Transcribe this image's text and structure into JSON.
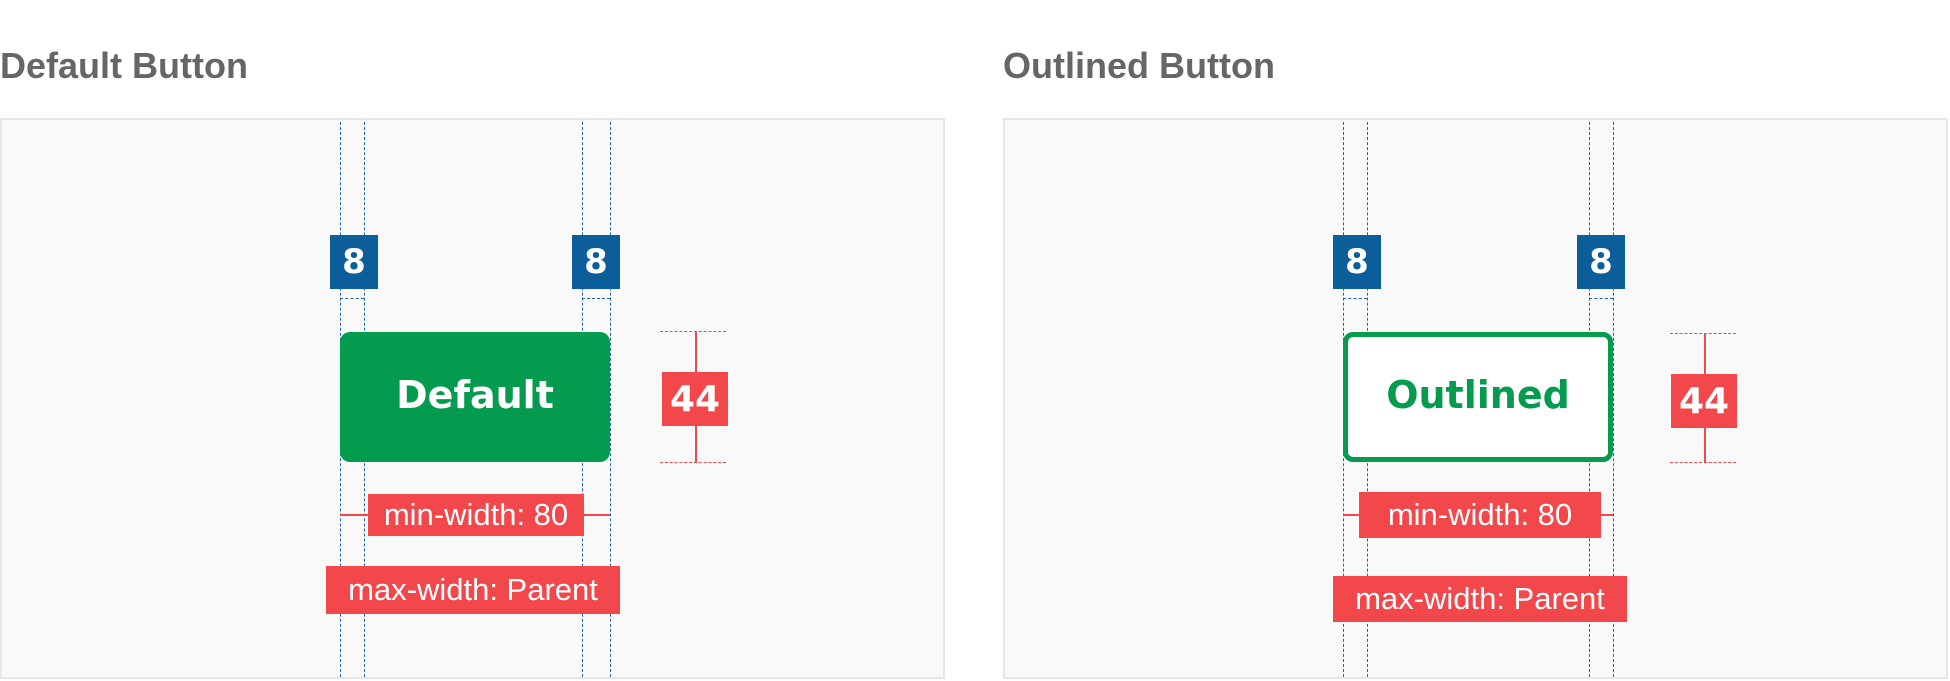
{
  "panels": [
    {
      "title": "Default Button",
      "button_label": "Default",
      "spacing_left": "8",
      "spacing_right": "8",
      "height_value": "44",
      "min_width_label": "min-width: 80",
      "max_width_label": "max-width: Parent"
    },
    {
      "title": "Outlined Button",
      "button_label": "Outlined",
      "spacing_left": "8",
      "spacing_right": "8",
      "height_value": "44",
      "min_width_label": "min-width: 80",
      "max_width_label": "max-width: Parent"
    }
  ],
  "colors": {
    "button_green": "#049b4f",
    "annotation_red": "#f2474b",
    "guide_blue": "#0b5e9a",
    "panel_bg": "#f9f9f9",
    "title_gray": "#666666"
  }
}
